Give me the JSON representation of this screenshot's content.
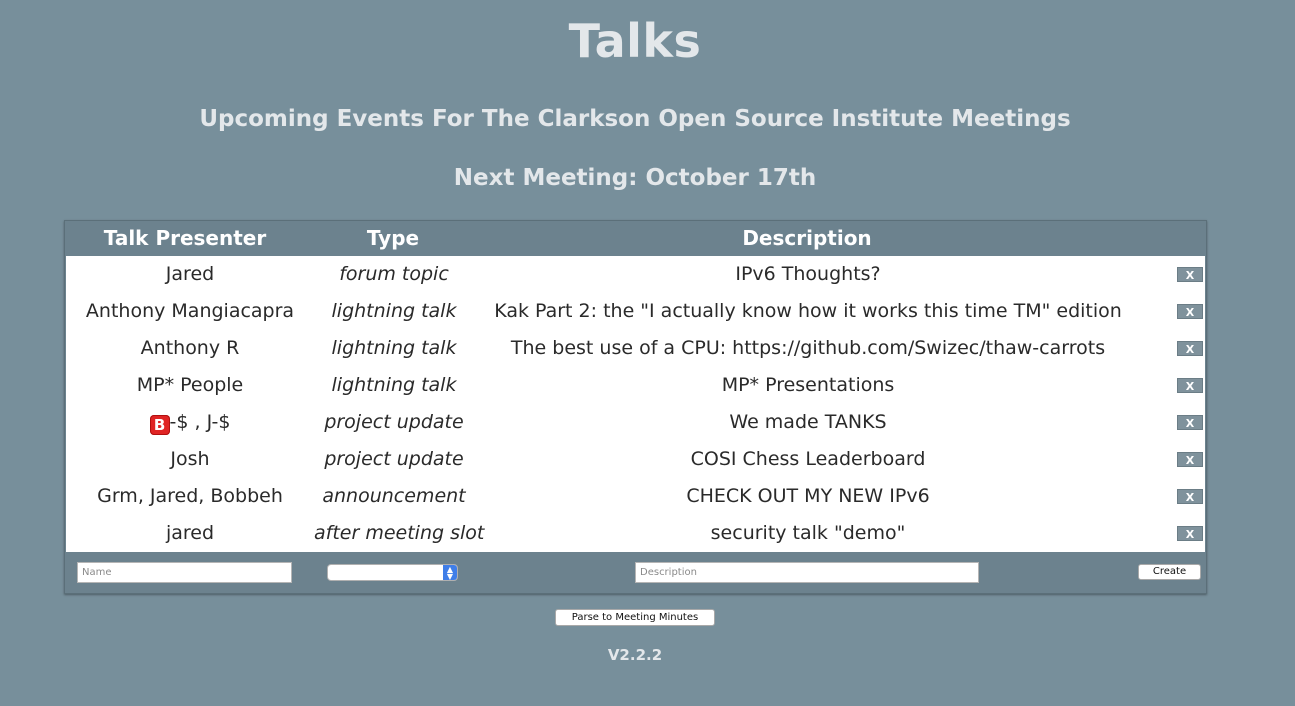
{
  "header": {
    "title": "Talks",
    "subtitle": "Upcoming Events For The Clarkson Open Source Institute Meetings",
    "next_meeting": "Next Meeting: October 17th"
  },
  "table": {
    "columns": [
      "Talk Presenter",
      "Type",
      "Description"
    ],
    "rows": [
      {
        "presenter": "Jared",
        "type": "forum topic",
        "description": "IPv6 Thoughts?"
      },
      {
        "presenter": "Anthony Mangiacapra",
        "type": "lightning talk",
        "description": "Kak Part 2: the \"I actually know how it works this time TM\" edition"
      },
      {
        "presenter": "Anthony R",
        "type": "lightning talk",
        "description": "The best use of a CPU: https://github.com/Swizec/thaw-carrots"
      },
      {
        "presenter": "MP* People",
        "type": "lightning talk",
        "description": "MP* Presentations"
      },
      {
        "presenter_icon": "B",
        "presenter": "-$ , J-$",
        "type": "project update",
        "description": "We made TANKS"
      },
      {
        "presenter": "Josh",
        "type": "project update",
        "description": "COSI Chess Leaderboard"
      },
      {
        "presenter": "Grm, Jared, Bobbeh",
        "type": "announcement",
        "description": "CHECK OUT MY NEW IPv6"
      },
      {
        "presenter": "jared",
        "type": "after meeting slot",
        "description": "security talk \"demo\""
      }
    ],
    "delete_label": "X"
  },
  "form": {
    "name_placeholder": "Name",
    "type_selected": "",
    "description_placeholder": "Description",
    "create_label": "Create"
  },
  "footer": {
    "parse_label": "Parse to Meeting Minutes",
    "version": "V2.2.2"
  },
  "colors": {
    "background": "#778f9b",
    "table_header": "#6c828e",
    "delete_button": "#7f929c",
    "select_arrow": "#3f7ee8"
  }
}
